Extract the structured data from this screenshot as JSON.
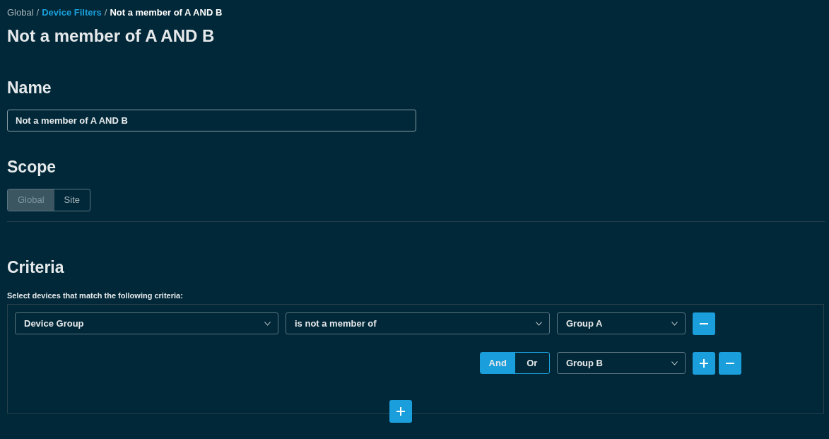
{
  "breadcrumb": [
    {
      "label": "Global",
      "kind": "text"
    },
    {
      "label": "/",
      "kind": "separator"
    },
    {
      "label": "Device Filters",
      "kind": "link"
    },
    {
      "label": "/",
      "kind": "separator"
    },
    {
      "label": "Not a member of A AND B",
      "kind": "current"
    }
  ],
  "title": "Not a member of A AND B",
  "name_section": {
    "heading": "Name",
    "value": "Not a member of A AND B"
  },
  "scope_section": {
    "heading": "Scope",
    "options": [
      {
        "label": "Global",
        "selected": true
      },
      {
        "label": "Site",
        "selected": false
      }
    ]
  },
  "criteria_section": {
    "heading": "Criteria",
    "description": "Select devices that match the following criteria:",
    "rows": [
      {
        "field": "Device Group",
        "operator": "is not a member of",
        "value": "Group A",
        "actions": [
          {
            "kind": "remove"
          }
        ]
      },
      {
        "logic": [
          {
            "label": "And",
            "selected": true
          },
          {
            "label": "Or",
            "selected": false
          }
        ],
        "value": "Group B",
        "actions": [
          {
            "kind": "add"
          },
          {
            "kind": "remove"
          }
        ]
      }
    ],
    "footer_action": {
      "kind": "add"
    }
  }
}
